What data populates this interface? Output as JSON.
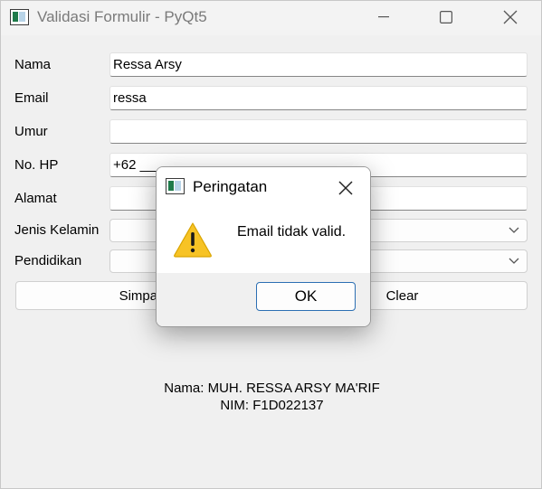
{
  "window": {
    "title": "Validasi Formulir - PyQt5"
  },
  "form": {
    "nama_label": "Nama",
    "nama_value": "Ressa Arsy",
    "email_label": "Email",
    "email_value": "ressa",
    "umur_label": "Umur",
    "umur_value": "",
    "hp_label": "No. HP",
    "hp_value": "+62 ____",
    "alamat_label": "Alamat",
    "alamat_value": "",
    "gender_label": "Jenis Kelamin",
    "gender_value": "",
    "pendidikan_label": "Pendidikan",
    "pendidikan_value": ""
  },
  "actions": {
    "simpan_label": "Simpan",
    "clear_label": "Clear"
  },
  "footer": {
    "name_line": "Nama: MUH. RESSA ARSY MA'RIF",
    "nim_line": "NIM: F1D022137"
  },
  "dialog": {
    "title": "Peringatan",
    "message": "Email tidak valid.",
    "ok_label": "OK",
    "icon": "warning-icon"
  },
  "colors": {
    "window_bg": "#f0f0f0",
    "accent_border": "#2c6fb3",
    "warning_yellow": "#f7c325"
  }
}
